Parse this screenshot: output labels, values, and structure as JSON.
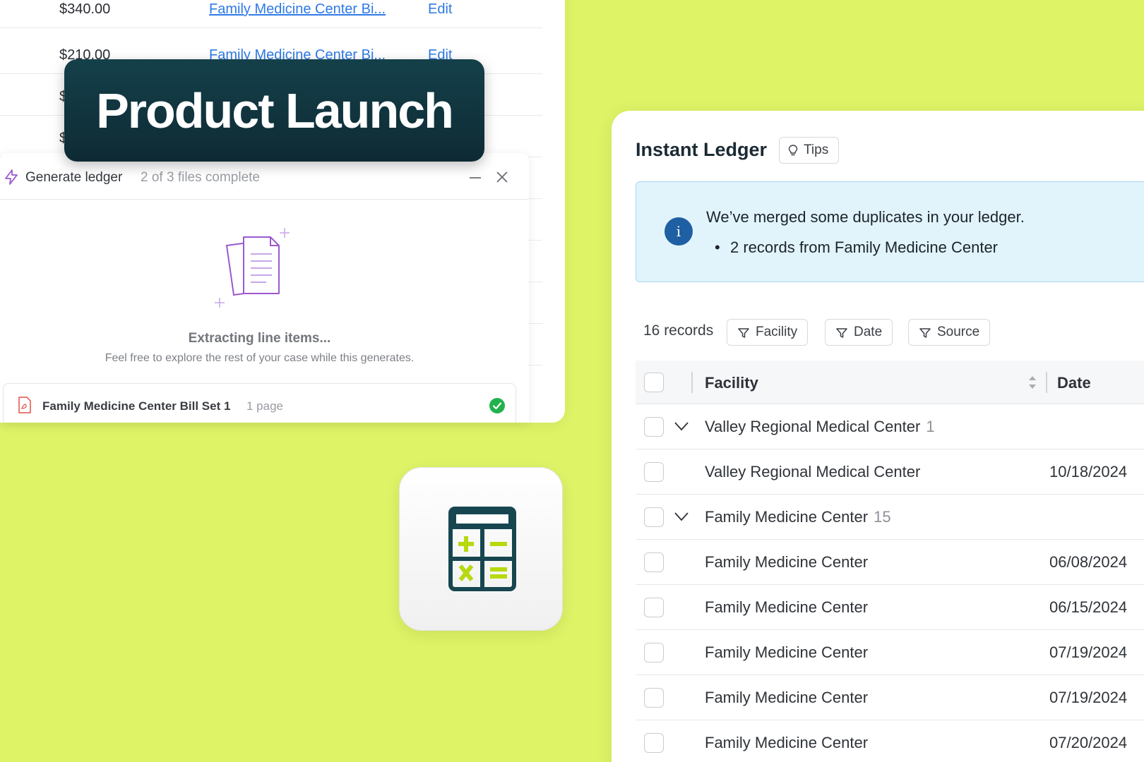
{
  "background_table": {
    "rows": [
      {
        "amount": "$340.00",
        "link": "Family Medicine Center Bi...",
        "action": "Edit"
      },
      {
        "amount": "$210.00",
        "link": "Family Medicine Center Bi...",
        "action": "Edit"
      },
      {
        "amount": "$",
        "link": "",
        "action": ""
      },
      {
        "amount": "$",
        "link": "",
        "action": ""
      }
    ]
  },
  "launch_badge": {
    "text": "Product Launch"
  },
  "generate_panel": {
    "title": "Generate ledger",
    "progress": "2 of 3 files complete",
    "status": "Extracting line items...",
    "hint": "Feel free to explore the rest of your case while this generates.",
    "file": {
      "name": "Family Medicine Center Bill Set 1",
      "pages": "1 page",
      "status": "complete"
    }
  },
  "ledger": {
    "title": "Instant Ledger",
    "tips_label": "Tips",
    "alert": {
      "icon": "i",
      "title": "We’ve merged some duplicates in your ledger.",
      "bullet": "•",
      "item": "2 records from Family Medicine Center"
    },
    "record_count": "16 records",
    "filters": [
      "Facility",
      "Date",
      "Source"
    ],
    "columns": {
      "facility": "Facility",
      "date": "Date"
    },
    "rows": [
      {
        "type": "group",
        "facility": "Valley Regional Medical Center",
        "count": "1",
        "date": ""
      },
      {
        "type": "item",
        "facility": "Valley Regional Medical Center",
        "count": "",
        "date": "10/18/2024"
      },
      {
        "type": "group",
        "facility": "Family Medicine Center",
        "count": "15",
        "date": ""
      },
      {
        "type": "item",
        "facility": "Family Medicine Center",
        "count": "",
        "date": "06/08/2024"
      },
      {
        "type": "item",
        "facility": "Family Medicine Center",
        "count": "",
        "date": "06/15/2024"
      },
      {
        "type": "item",
        "facility": "Family Medicine Center",
        "count": "",
        "date": "07/19/2024"
      },
      {
        "type": "item",
        "facility": "Family Medicine Center",
        "count": "",
        "date": "07/19/2024"
      },
      {
        "type": "item",
        "facility": "Family Medicine Center",
        "count": "",
        "date": "07/20/2024"
      }
    ]
  },
  "colors": {
    "background": "#def366",
    "badge": "#0e2a34",
    "link": "#2f7ae5",
    "info_icon": "#1f5fa3",
    "calculator_dark": "#174650",
    "calculator_accent": "#b7d90f"
  },
  "icons": [
    "bolt-icon",
    "minimize-icon",
    "close-icon",
    "document-illustration",
    "pdf-icon",
    "check-circle-icon",
    "calculator-icon",
    "lightbulb-icon",
    "info-icon",
    "filter-icon",
    "sort-icon",
    "chevron-down-icon"
  ]
}
